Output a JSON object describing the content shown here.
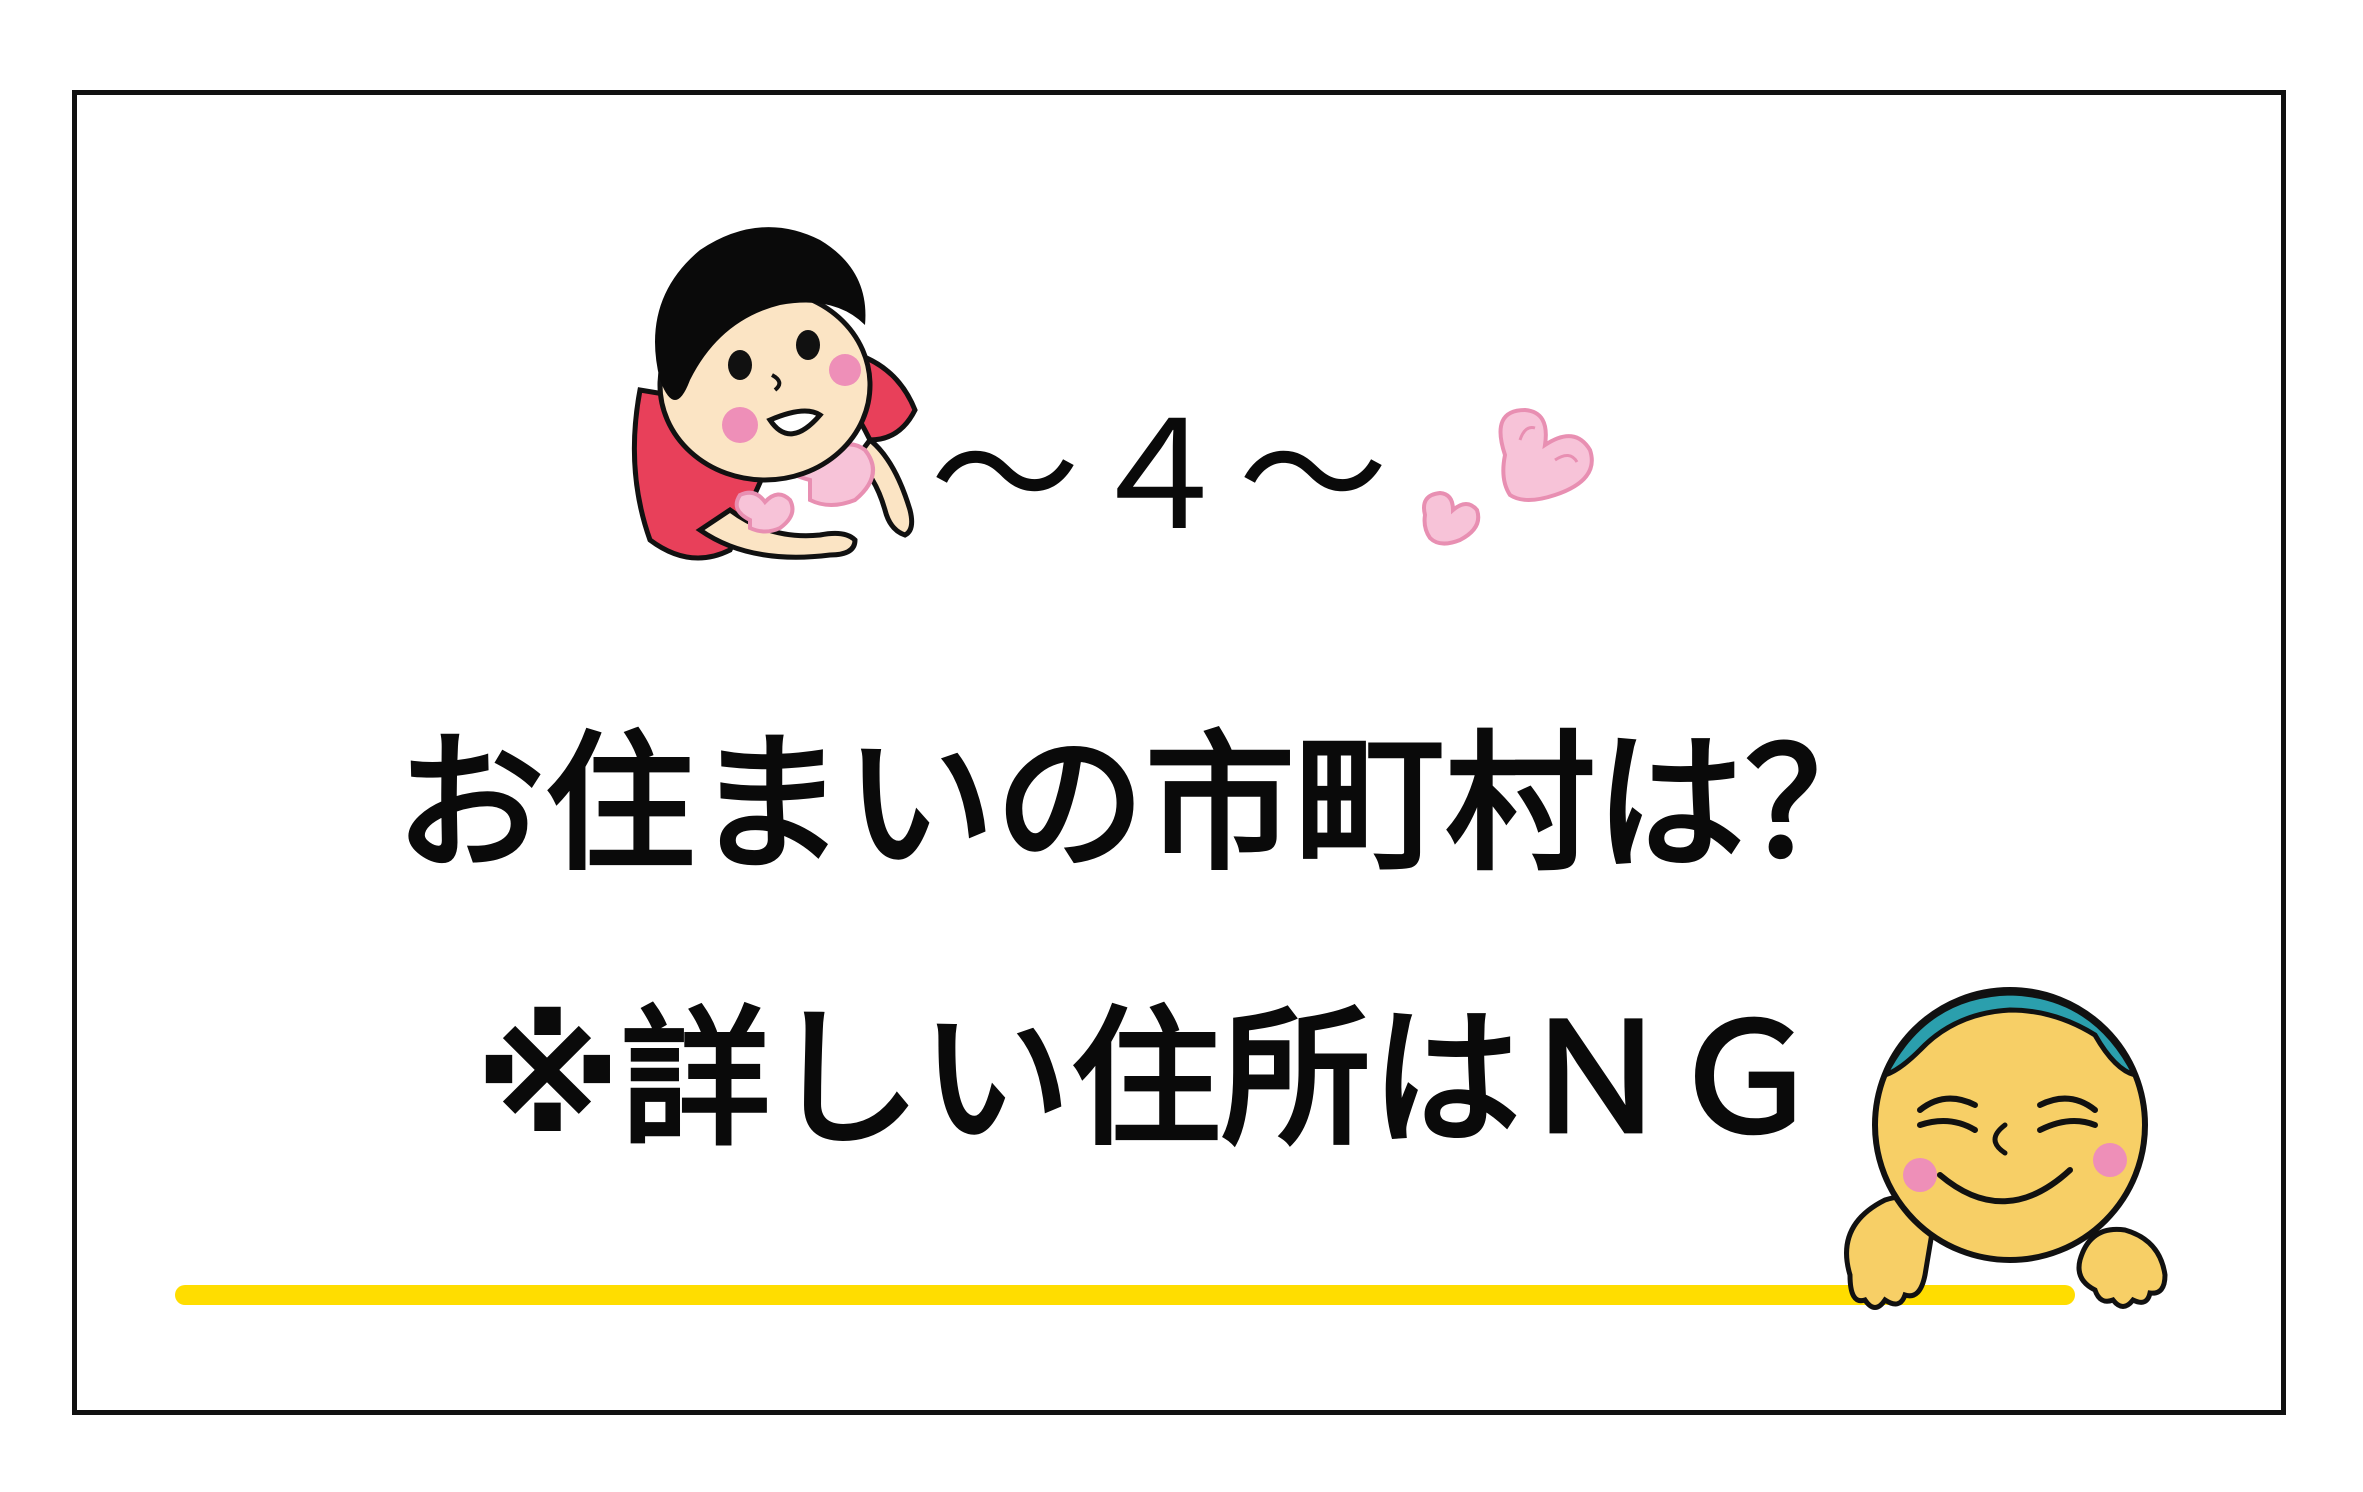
{
  "heading": {
    "number_label": "～４～"
  },
  "question": {
    "text": "お住まいの市町村は？"
  },
  "note": {
    "text": "※詳しい住所はＮＧ"
  },
  "icons": {
    "girl": "girl-with-heart-illustration",
    "hearts": "pink-hearts-icon",
    "boy": "smiling-boy-peeking-illustration"
  },
  "colors": {
    "frame": "#111111",
    "underline": "#ffdd00",
    "girl_shirt": "#e8405a",
    "heart_pink": "#f7c3d8",
    "boy_face": "#f7cf66",
    "boy_cap": "#2b9fad",
    "cheek": "#ee8fb8"
  }
}
